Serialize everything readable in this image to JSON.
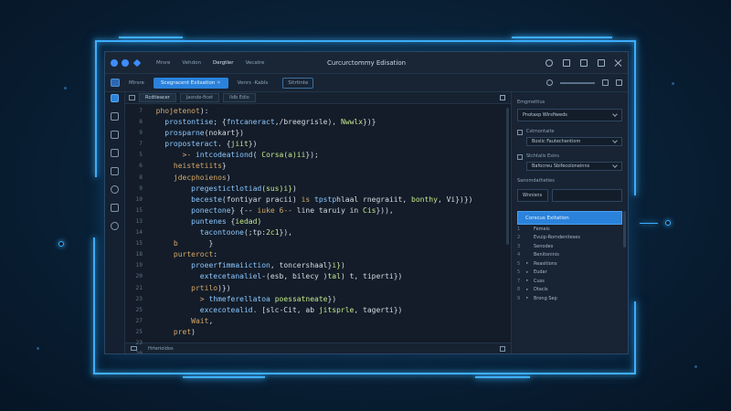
{
  "colors": {
    "accent": "#2a82db",
    "frame_glow": "#3fb0ff",
    "background": "#0a2238"
  },
  "window": {
    "title": "Curcurctommy Edisation",
    "menu": [
      "Mrsre",
      "Vehdon",
      "Dergtler",
      "Vecatre"
    ],
    "menu_active_index": 2
  },
  "toolbar": {
    "items": [
      "Mlrsre"
    ],
    "primary_label": "Scegracent Exlisation ✧",
    "mode_label": "Venrs ·Kabls",
    "outline_label": "Sitrtinte"
  },
  "tabs": [
    "Rcdtieacer",
    "Jasnde-ficet",
    "Ildb Edio"
  ],
  "tabs_active_index": 0,
  "code": {
    "line_numbers": [
      "7",
      "8",
      "9",
      "7",
      "5",
      "6",
      "8",
      "9",
      "10",
      "15",
      "13",
      "14",
      "15",
      "18",
      "19",
      "20",
      "21",
      "23",
      "25",
      "27",
      "25",
      "23",
      "20",
      "22"
    ],
    "lines": [
      [
        {
          "t": "  ",
          "c": "plain"
        },
        {
          "t": "phojetenot",
          "c": "kw"
        },
        {
          "t": "):",
          "c": "plain"
        }
      ],
      [
        {
          "t": "    ",
          "c": "plain"
        },
        {
          "t": "prostontise",
          "c": "fn"
        },
        {
          "t": "; {",
          "c": "plain"
        },
        {
          "t": "fntcaneract",
          "c": "fn"
        },
        {
          "t": ",/breegrisle), ",
          "c": "plain"
        },
        {
          "t": "Nwwlx",
          "c": "str"
        },
        {
          "t": "})}",
          "c": "plain"
        }
      ],
      [
        {
          "t": "    ",
          "c": "plain"
        },
        {
          "t": "prosparne",
          "c": "fn"
        },
        {
          "t": "(nokart})",
          "c": "plain"
        }
      ],
      [
        {
          "t": "    ",
          "c": "plain"
        },
        {
          "t": "proposteract",
          "c": "fn"
        },
        {
          "t": ". {",
          "c": "plain"
        },
        {
          "t": "jiit",
          "c": "str"
        },
        {
          "t": "})",
          "c": "plain"
        }
      ],
      [
        {
          "t": "        ",
          "c": "plain"
        },
        {
          "t": ">- ",
          "c": "kw"
        },
        {
          "t": "intcodeationd",
          "c": "fn"
        },
        {
          "t": "( ",
          "c": "plain"
        },
        {
          "t": "Corsa(a)ii",
          "c": "str"
        },
        {
          "t": "});",
          "c": "plain"
        }
      ],
      [
        {
          "t": "      ",
          "c": "plain"
        },
        {
          "t": "heistetiits",
          "c": "kw"
        },
        {
          "t": "}",
          "c": "plain"
        }
      ],
      [
        {
          "t": "      ",
          "c": "plain"
        },
        {
          "t": "jdecphoienos",
          "c": "kw"
        },
        {
          "t": ")",
          "c": "plain"
        }
      ],
      [
        {
          "t": "          ",
          "c": "plain"
        },
        {
          "t": "pregestictlotiad",
          "c": "fn"
        },
        {
          "t": "(sus)i}",
          "c": "str"
        },
        {
          "t": ")",
          "c": "plain"
        }
      ],
      [
        {
          "t": "          ",
          "c": "plain"
        },
        {
          "t": "beceste",
          "c": "fn"
        },
        {
          "t": "(fontiyar pracii) ",
          "c": "plain"
        },
        {
          "t": "is ",
          "c": "kw"
        },
        {
          "t": "tpstp",
          "c": "fn"
        },
        {
          "t": "hlaal rnegraiit, ",
          "c": "plain"
        },
        {
          "t": "bonthy",
          "c": "str"
        },
        {
          "t": ", Vi})})",
          "c": "plain"
        }
      ],
      [
        {
          "t": "          ",
          "c": "plain"
        },
        {
          "t": "ponectone",
          "c": "fn"
        },
        {
          "t": "} {-- ",
          "c": "plain"
        },
        {
          "t": "iuke 6--",
          "c": "kw"
        },
        {
          "t": " line taruiy in ",
          "c": "plain"
        },
        {
          "t": "Cis",
          "c": "str"
        },
        {
          "t": "})),",
          "c": "plain"
        }
      ],
      [
        {
          "t": "          ",
          "c": "plain"
        },
        {
          "t": "puntenes",
          "c": "fn"
        },
        {
          "t": " {",
          "c": "plain"
        },
        {
          "t": "iedad",
          "c": "str"
        },
        {
          "t": ")",
          "c": "plain"
        }
      ],
      [
        {
          "t": "            ",
          "c": "plain"
        },
        {
          "t": "tacontoone",
          "c": "fn"
        },
        {
          "t": "(;tp:",
          "c": "plain"
        },
        {
          "t": "2c1",
          "c": "str"
        },
        {
          "t": "}),",
          "c": "plain"
        }
      ],
      [
        {
          "t": "      ",
          "c": "plain"
        },
        {
          "t": "b",
          "c": "kw"
        },
        {
          "t": "       }",
          "c": "plain"
        }
      ],
      [
        {
          "t": "      ",
          "c": "plain"
        },
        {
          "t": "purteroct",
          "c": "kw"
        },
        {
          "t": ":",
          "c": "plain"
        }
      ],
      [
        {
          "t": "          ",
          "c": "plain"
        },
        {
          "t": "proeerfimmaiiction",
          "c": "fn"
        },
        {
          "t": ", toncershaal}",
          "c": "plain"
        },
        {
          "t": "i}",
          "c": "str"
        },
        {
          "t": ")",
          "c": "plain"
        }
      ],
      [
        {
          "t": "            ",
          "c": "plain"
        },
        {
          "t": "extecetanaliel",
          "c": "fn"
        },
        {
          "t": "-(esb, bilecy )",
          "c": "plain"
        },
        {
          "t": "tal",
          "c": "str"
        },
        {
          "t": ") t, tiperti})",
          "c": "plain"
        }
      ],
      [
        {
          "t": "          ",
          "c": "plain"
        },
        {
          "t": "prtilo",
          "c": "kw"
        },
        {
          "t": ")})",
          "c": "plain"
        }
      ],
      [
        {
          "t": "            ",
          "c": "plain"
        },
        {
          "t": "> ",
          "c": "kw"
        },
        {
          "t": "thmeferellatoa",
          "c": "fn"
        },
        {
          "t": " ",
          "c": "plain"
        },
        {
          "t": "poessatneate",
          "c": "str"
        },
        {
          "t": "})",
          "c": "plain"
        }
      ],
      [
        {
          "t": "            ",
          "c": "plain"
        },
        {
          "t": "excecotealid",
          "c": "fn"
        },
        {
          "t": ". [slc-Cit, ab ",
          "c": "plain"
        },
        {
          "t": "jitsprle",
          "c": "str"
        },
        {
          "t": ", tagerti})",
          "c": "plain"
        }
      ],
      [
        {
          "t": "          ",
          "c": "plain"
        },
        {
          "t": "Wait",
          "c": "kw"
        },
        {
          "t": ",",
          "c": "plain"
        }
      ],
      [
        {
          "t": "      ",
          "c": "plain"
        },
        {
          "t": "pret",
          "c": "kw"
        },
        {
          "t": ")",
          "c": "plain"
        }
      ],
      [
        {
          "t": "",
          "c": "plain"
        }
      ],
      [
        {
          "t": "",
          "c": "plain"
        }
      ],
      [
        {
          "t": "",
          "c": "plain"
        }
      ]
    ]
  },
  "status_bar": {
    "text": "Hrterioldos"
  },
  "panel": {
    "header": "Emgmettlus",
    "field1": "Pnotaxp Wirsfiweds",
    "group1_label": "Cstmontaite",
    "group1_value": "Boslic Fautechentiom",
    "group2_label": "Stchtalis Esins",
    "group2_value": "Bafocreu Sbifecoloneinns",
    "section_label": "Sanomdatheties",
    "split_first": "Wnnisns",
    "split_second": "",
    "tree_header": "Corscus Exitation",
    "tree": [
      {
        "num": "1",
        "arrow": "",
        "label": "Femeis"
      },
      {
        "num": "2",
        "arrow": "",
        "label": "Evuip-Romdeniteses"
      },
      {
        "num": "3",
        "arrow": "",
        "label": "Senodes"
      },
      {
        "num": "4",
        "arrow": "",
        "label": "Benitoninis"
      },
      {
        "num": "5",
        "arrow": "▸",
        "label": "Reasitions"
      },
      {
        "num": "5",
        "arrow": "▸",
        "label": "Eudar"
      },
      {
        "num": "7",
        "arrow": "▸",
        "label": "Cuss"
      },
      {
        "num": "8",
        "arrow": "▸",
        "label": "Dtacis"
      },
      {
        "num": "9",
        "arrow": "▸",
        "label": "Brong Sep"
      }
    ]
  }
}
